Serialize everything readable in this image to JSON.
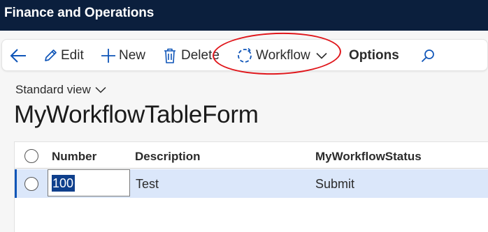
{
  "app": {
    "title": "Finance and Operations"
  },
  "actionbar": {
    "edit_label": "Edit",
    "new_label": "New",
    "delete_label": "Delete",
    "workflow_label": "Workflow",
    "options_label": "Options"
  },
  "view": {
    "selector_label": "Standard view"
  },
  "page": {
    "title": "MyWorkflowTableForm"
  },
  "grid": {
    "columns": [
      "Number",
      "Description",
      "MyWorkflowStatus"
    ],
    "rows": [
      {
        "number": "100",
        "description": "Test",
        "status": "Submit",
        "selected": true
      }
    ]
  },
  "colors": {
    "titlebar": "#0b1f3d",
    "annotation": "#e0161b",
    "selected_row": "#dbe7fa",
    "accent": "#0f55b8"
  },
  "icons": [
    "back-arrow-icon",
    "pencil-icon",
    "plus-icon",
    "trash-icon",
    "workflow-icon",
    "chevron-down-icon",
    "search-icon"
  ]
}
